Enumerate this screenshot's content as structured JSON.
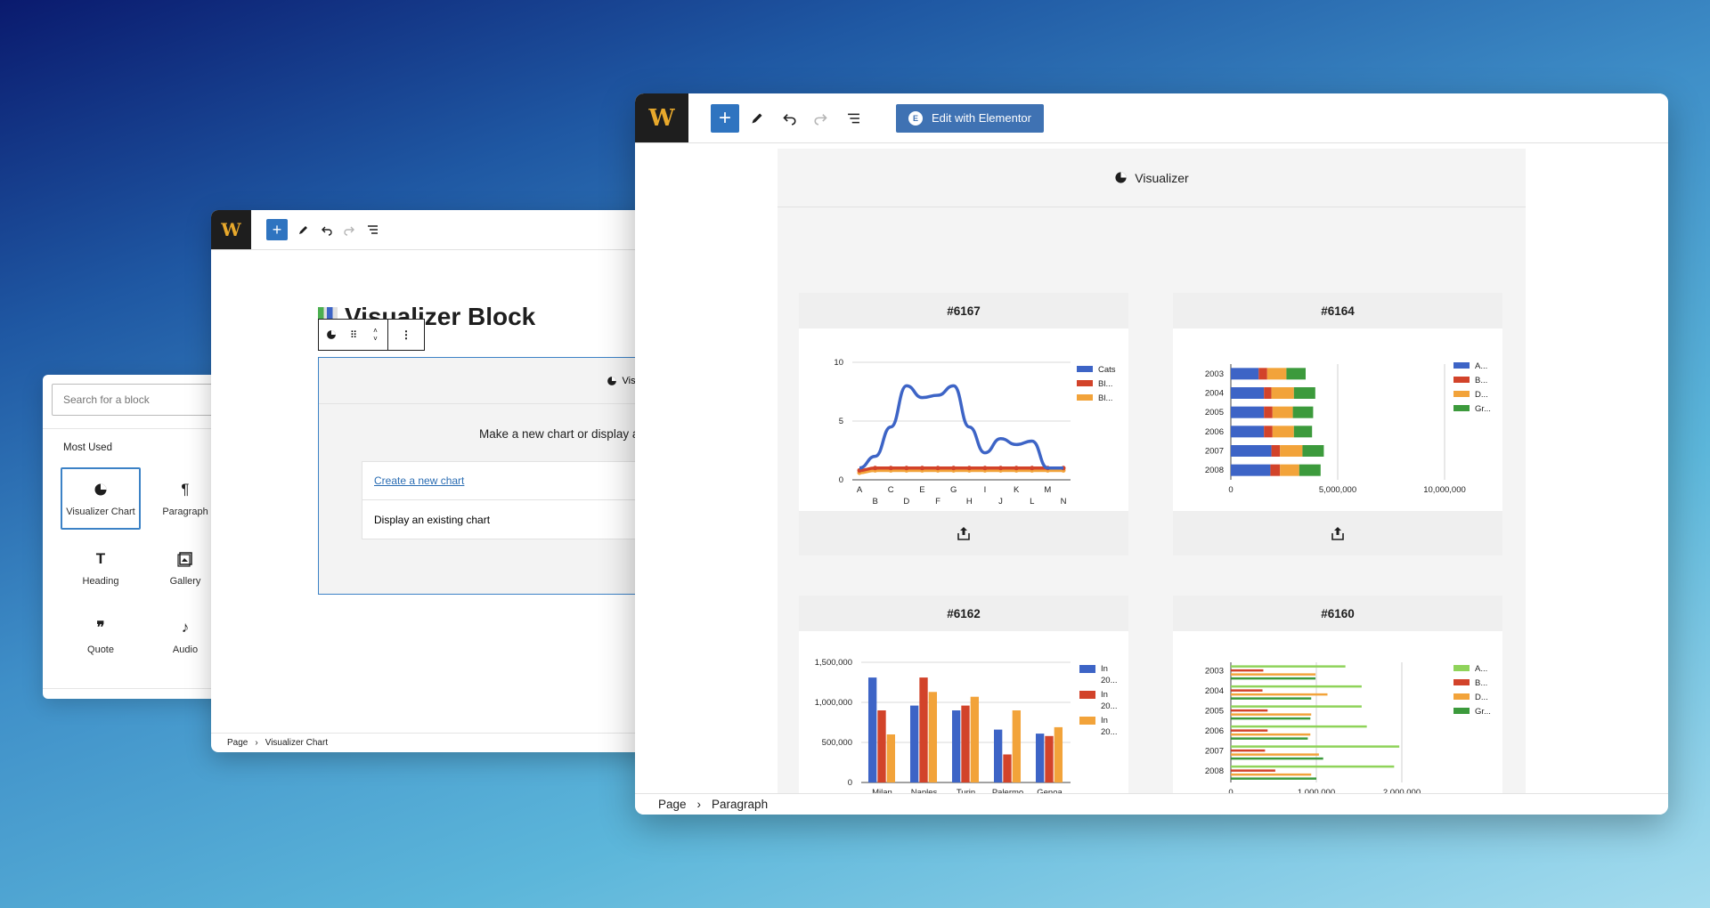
{
  "inserter": {
    "search_placeholder": "Search for a block",
    "section_label": "Most Used",
    "blocks": [
      {
        "label": "Visualizer Chart",
        "icon": "pie-chart-icon"
      },
      {
        "label": "Paragraph",
        "icon": "pilcrow-icon"
      },
      {
        "label": "Heading",
        "icon": "heading-icon"
      },
      {
        "label": "Gallery",
        "icon": "gallery-icon"
      },
      {
        "label": "Quote",
        "icon": "quote-icon"
      },
      {
        "label": "Audio",
        "icon": "music-note-icon"
      }
    ]
  },
  "editor_small": {
    "page_title": "Visualizer Block",
    "block_header": "Visualizer",
    "prompt": "Make a new chart or display a",
    "option_new": "Create a new chart",
    "option_existing": "Display an existing chart",
    "breadcrumb": [
      "Page",
      "Visualizer Chart"
    ]
  },
  "editor_large": {
    "toolbar": {
      "elementor_label": "Edit with Elementor"
    },
    "block_header": "Visualizer",
    "charts": [
      {
        "id": "#6167"
      },
      {
        "id": "#6164"
      },
      {
        "id": "#6162"
      },
      {
        "id": "#6160"
      }
    ],
    "breadcrumb": [
      "Page",
      "Paragraph"
    ]
  },
  "colors": {
    "accent": "#2f74c0",
    "blue": "#3d64c6",
    "red": "#d2432a",
    "orange": "#f2a33a",
    "green": "#3c9a3c",
    "lightgreen": "#8fd35a"
  },
  "chart_data": [
    {
      "type": "line",
      "title": "#6167",
      "x": [
        "A",
        "B",
        "C",
        "D",
        "E",
        "F",
        "G",
        "H",
        "I",
        "J",
        "K",
        "L",
        "M",
        "N"
      ],
      "ylim": [
        0,
        10
      ],
      "yticks": [
        0,
        5,
        10
      ],
      "legend_position": "right",
      "series": [
        {
          "name": "Cats",
          "values": [
            1,
            2,
            4.5,
            8,
            7,
            7.2,
            8,
            4.5,
            2.3,
            3.5,
            3,
            3.3,
            1,
            1
          ],
          "color": "#3d64c6"
        },
        {
          "name": "Bl...",
          "values": [
            0.8,
            1,
            1,
            1,
            1,
            1,
            1,
            1,
            1,
            1,
            1,
            1,
            1,
            1
          ],
          "color": "#d2432a"
        },
        {
          "name": "Bl...",
          "values": [
            0.6,
            0.8,
            0.8,
            0.8,
            0.8,
            0.8,
            0.8,
            0.8,
            0.8,
            0.8,
            0.8,
            0.8,
            0.8,
            0.8
          ],
          "color": "#f2a33a"
        }
      ]
    },
    {
      "type": "bar",
      "orientation": "horizontal",
      "stacked": true,
      "title": "#6164",
      "categories": [
        "2003",
        "2004",
        "2005",
        "2006",
        "2007",
        "2008"
      ],
      "xlim": [
        0,
        10000000
      ],
      "xticks": [
        "0",
        "5,000,000",
        "10,000,000"
      ],
      "legend_position": "right",
      "series": [
        {
          "name": "A...",
          "values": [
            1300000,
            1550000,
            1550000,
            1550000,
            1900000,
            1850000
          ],
          "color": "#3d64c6"
        },
        {
          "name": "B...",
          "values": [
            400000,
            350000,
            400000,
            400000,
            400000,
            450000
          ],
          "color": "#d2432a"
        },
        {
          "name": "D...",
          "values": [
            900000,
            1050000,
            950000,
            1000000,
            1050000,
            900000
          ],
          "color": "#f2a33a"
        },
        {
          "name": "Gr...",
          "values": [
            900000,
            1000000,
            950000,
            850000,
            1000000,
            1000000
          ],
          "color": "#3c9a3c"
        }
      ]
    },
    {
      "type": "bar",
      "title": "#6162",
      "categories": [
        "Milan",
        "Naples",
        "Turin",
        "Palermo",
        "Genoa"
      ],
      "ylim": [
        0,
        1500000
      ],
      "yticks": [
        "0",
        "500,000",
        "1,000,000",
        "1,500,000"
      ],
      "legend_position": "right",
      "series": [
        {
          "name": "In 20...",
          "values": [
            1310000,
            960000,
            900000,
            660000,
            610000
          ],
          "color": "#3d64c6"
        },
        {
          "name": "In 20...",
          "values": [
            900000,
            1310000,
            960000,
            350000,
            580000
          ],
          "color": "#d2432a"
        },
        {
          "name": "In 20...",
          "values": [
            600000,
            1130000,
            1070000,
            900000,
            690000
          ],
          "color": "#f2a33a"
        }
      ]
    },
    {
      "type": "bar",
      "orientation": "horizontal",
      "title": "#6160",
      "categories": [
        "2003",
        "2004",
        "2005",
        "2006",
        "2007",
        "2008"
      ],
      "xlim": [
        0,
        2500000
      ],
      "xticks": [
        "0",
        "1,000,000",
        "2,000,000"
      ],
      "legend_position": "right",
      "series": [
        {
          "name": "A...",
          "values": [
            1340000,
            1530000,
            1530000,
            1590000,
            1970000,
            1910000
          ],
          "color": "#8fd35a"
        },
        {
          "name": "B...",
          "values": [
            380000,
            370000,
            430000,
            430000,
            400000,
            520000
          ],
          "color": "#d2432a"
        },
        {
          "name": "D...",
          "values": [
            990000,
            1130000,
            940000,
            930000,
            1030000,
            940000
          ],
          "color": "#f2a33a"
        },
        {
          "name": "Gr...",
          "values": [
            990000,
            940000,
            930000,
            900000,
            1080000,
            1000000
          ],
          "color": "#3c9a3c"
        }
      ]
    }
  ]
}
